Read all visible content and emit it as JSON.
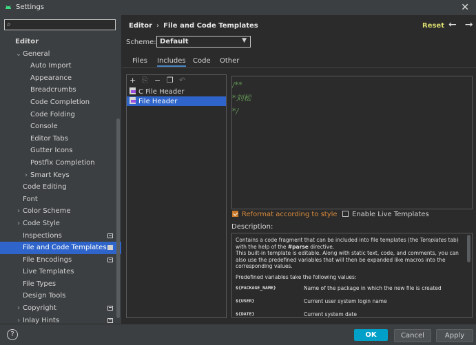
{
  "window": {
    "title": "Settings"
  },
  "search": {
    "placeholder": ""
  },
  "sidebar": {
    "items": [
      {
        "label": "Editor",
        "level": 1,
        "bold": true,
        "arrow": "",
        "badge": ""
      },
      {
        "label": "General",
        "level": 2,
        "bold": false,
        "arrow": "⌄",
        "badge": ""
      },
      {
        "label": "Auto Import",
        "level": 4,
        "bold": false,
        "arrow": "",
        "badge": ""
      },
      {
        "label": "Appearance",
        "level": 4,
        "bold": false,
        "arrow": "",
        "badge": ""
      },
      {
        "label": "Breadcrumbs",
        "level": 4,
        "bold": false,
        "arrow": "",
        "badge": ""
      },
      {
        "label": "Code Completion",
        "level": 4,
        "bold": false,
        "arrow": "",
        "badge": ""
      },
      {
        "label": "Code Folding",
        "level": 4,
        "bold": false,
        "arrow": "",
        "badge": ""
      },
      {
        "label": "Console",
        "level": 4,
        "bold": false,
        "arrow": "",
        "badge": ""
      },
      {
        "label": "Editor Tabs",
        "level": 4,
        "bold": false,
        "arrow": "",
        "badge": ""
      },
      {
        "label": "Gutter Icons",
        "level": 4,
        "bold": false,
        "arrow": "",
        "badge": ""
      },
      {
        "label": "Postfix Completion",
        "level": 4,
        "bold": false,
        "arrow": "",
        "badge": ""
      },
      {
        "label": "Smart Keys",
        "level": 3,
        "bold": false,
        "arrow": "›",
        "badge": ""
      },
      {
        "label": "Code Editing",
        "level": 2,
        "bold": false,
        "arrow": "",
        "badge": ""
      },
      {
        "label": "Font",
        "level": 2,
        "bold": false,
        "arrow": "",
        "badge": ""
      },
      {
        "label": "Color Scheme",
        "level": 2,
        "bold": false,
        "arrow": "›",
        "badge": ""
      },
      {
        "label": "Code Style",
        "level": 2,
        "bold": false,
        "arrow": "›",
        "badge": ""
      },
      {
        "label": "Inspections",
        "level": 2,
        "bold": false,
        "arrow": "",
        "badge": "project"
      },
      {
        "label": "File and Code Templates",
        "level": 2,
        "bold": false,
        "arrow": "",
        "badge": "project-sel",
        "selected": true
      },
      {
        "label": "File Encodings",
        "level": 2,
        "bold": false,
        "arrow": "",
        "badge": "project"
      },
      {
        "label": "Live Templates",
        "level": 2,
        "bold": false,
        "arrow": "",
        "badge": ""
      },
      {
        "label": "File Types",
        "level": 2,
        "bold": false,
        "arrow": "",
        "badge": ""
      },
      {
        "label": "Design Tools",
        "level": 2,
        "bold": false,
        "arrow": "",
        "badge": ""
      },
      {
        "label": "Copyright",
        "level": 2,
        "bold": false,
        "arrow": "›",
        "badge": "project"
      },
      {
        "label": "Inlay Hints",
        "level": 2,
        "bold": false,
        "arrow": "›",
        "badge": "project"
      }
    ]
  },
  "breadcrumb": {
    "part1": "Editor",
    "separator": "›",
    "part2": "File and Code Templates"
  },
  "header": {
    "reset": "Reset",
    "back": "←",
    "forward": "→"
  },
  "scheme": {
    "label": "Scheme:",
    "value": "Default"
  },
  "tabs": [
    {
      "label": "Files"
    },
    {
      "label": "Includes",
      "active": true
    },
    {
      "label": "Code"
    },
    {
      "label": "Other"
    }
  ],
  "toolbar": {
    "add": "+",
    "copy_dim": "⎘",
    "remove": "−",
    "duplicate": "❐",
    "revert": "↶"
  },
  "templates": [
    {
      "label": "C File Header",
      "selected": false
    },
    {
      "label": "File Header",
      "selected": true
    }
  ],
  "editor": {
    "lines": [
      "/**",
      "*刘松",
      "*/"
    ]
  },
  "options": {
    "reformat": "Reformat according to style",
    "reformat_checked": true,
    "live": "Enable Live Templates",
    "live_checked": false
  },
  "description": {
    "label": "Description:",
    "p1_a": "Contains a code fragment that can be included into file templates (the ",
    "p1_b": "Templates",
    "p1_c": " tab) with the help of the ",
    "p1_d": "#parse",
    "p1_e": " directive.",
    "p2": "This built-in template is editable. Along with static text, code, and comments, you can also use the predefined variables that will then be expanded like macros into the corresponding values.",
    "p3": "Predefined variables take the following values:",
    "vars": [
      {
        "name": "${PACKAGE_NAME}",
        "desc": "Name of the package in which the new file is created"
      },
      {
        "name": "${USER}",
        "desc": "Current user system login name"
      },
      {
        "name": "${DATE}",
        "desc": "Current system date"
      }
    ]
  },
  "footer": {
    "help": "?",
    "ok": "OK",
    "cancel": "Cancel",
    "apply": "Apply"
  }
}
